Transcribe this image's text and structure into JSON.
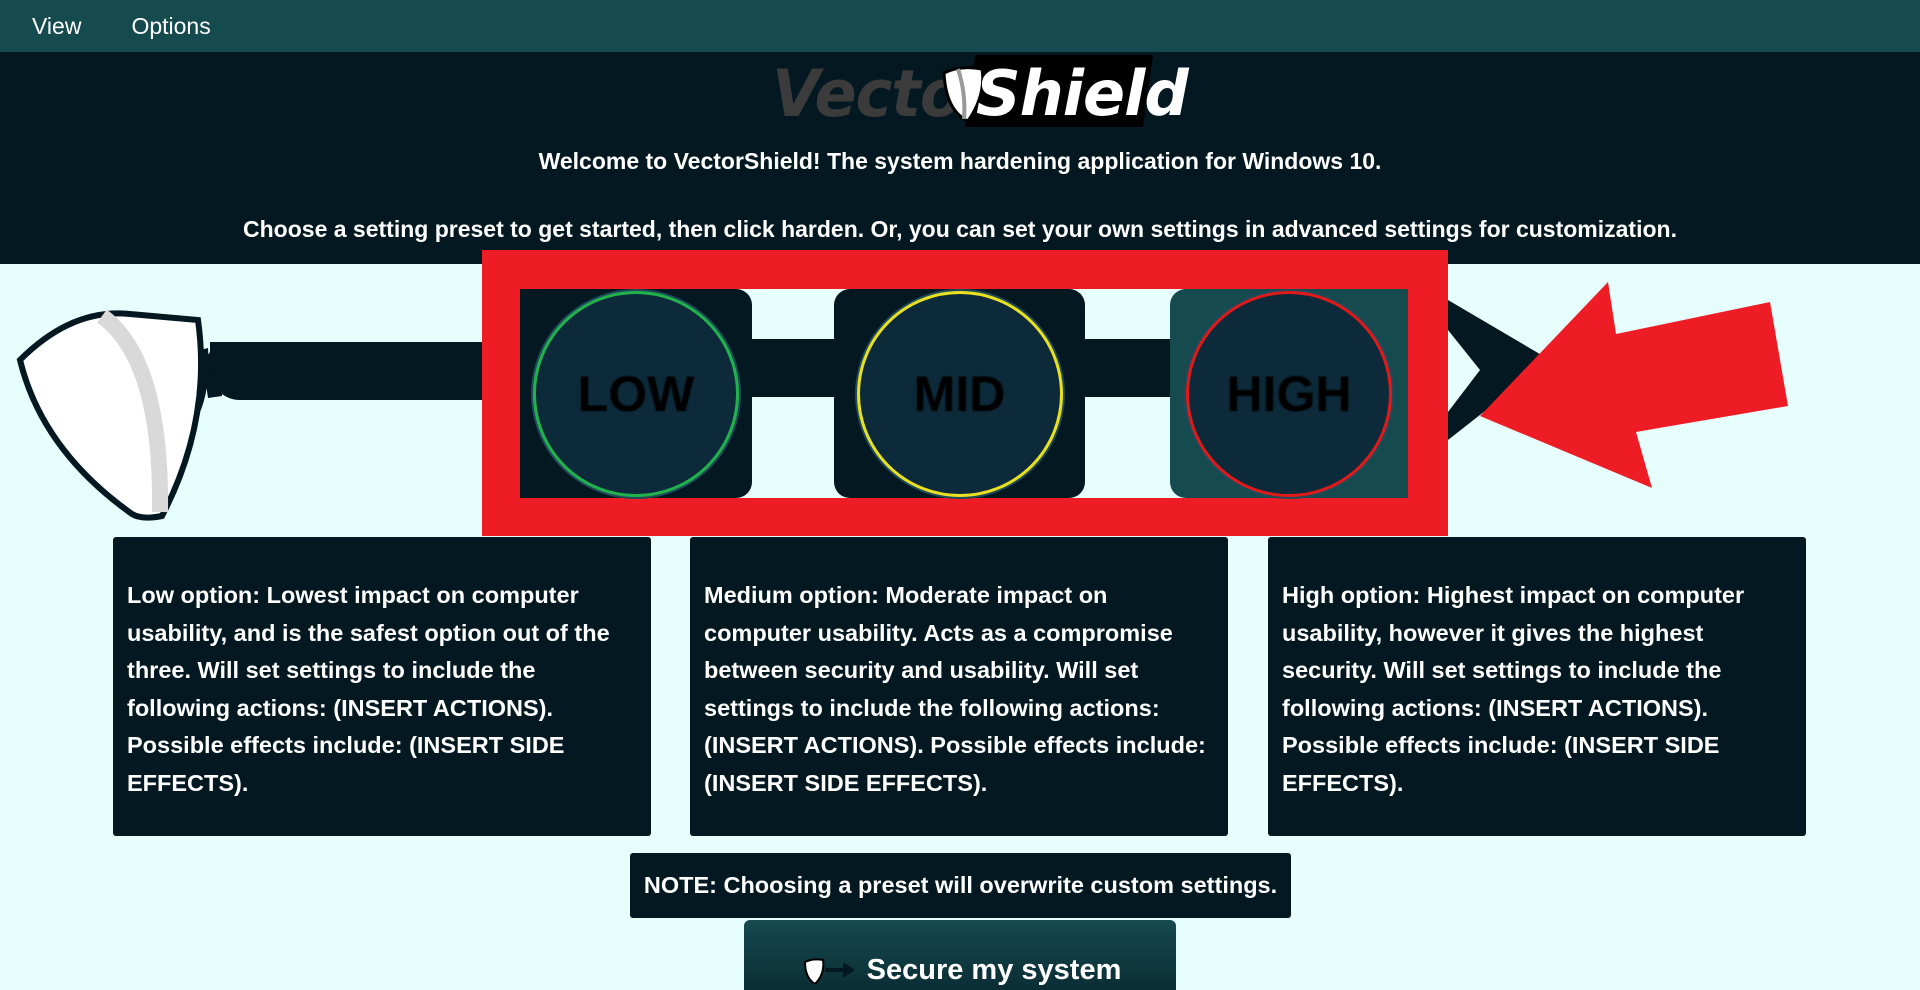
{
  "menu": {
    "items": [
      {
        "label": "View"
      },
      {
        "label": "Options"
      }
    ]
  },
  "header": {
    "logo_part1": "Vector",
    "logo_part2": "Shield",
    "welcome": "Welcome to VectorShield! The system hardening application for Windows 10.",
    "instructions": "Choose a setting preset to get started, then click harden. Or, you can set your own settings in advanced settings for customization."
  },
  "presets": [
    {
      "label": "LOW",
      "ring_color": "#22b24c"
    },
    {
      "label": "MID",
      "ring_color": "#e8e020"
    },
    {
      "label": "HIGH",
      "ring_color": "#e01919"
    }
  ],
  "descriptions": [
    {
      "text": "Low option: Lowest impact on computer usability, and is the safest option out of the three. Will set settings to include the following actions: (INSERT ACTIONS). Possible effects include: (INSERT SIDE EFFECTS)."
    },
    {
      "text": "Medium option: Moderate impact on computer usability. Acts as a compromise between security and usability. Will set settings to include the following actions: (INSERT ACTIONS). Possible effects include: (INSERT SIDE EFFECTS)."
    },
    {
      "text": "High option: Highest impact on computer usability, however it gives the highest security. Will set settings to include the following actions: (INSERT ACTIONS). Possible effects include: (INSERT SIDE EFFECTS)."
    }
  ],
  "note": "NOTE: Choosing a preset will overwrite custom settings.",
  "secure_button": {
    "label": "Secure my system"
  },
  "colors": {
    "menubar": "#154a4f",
    "header": "#031820",
    "background": "#e6fffd",
    "highlight": "#ee1c25"
  }
}
